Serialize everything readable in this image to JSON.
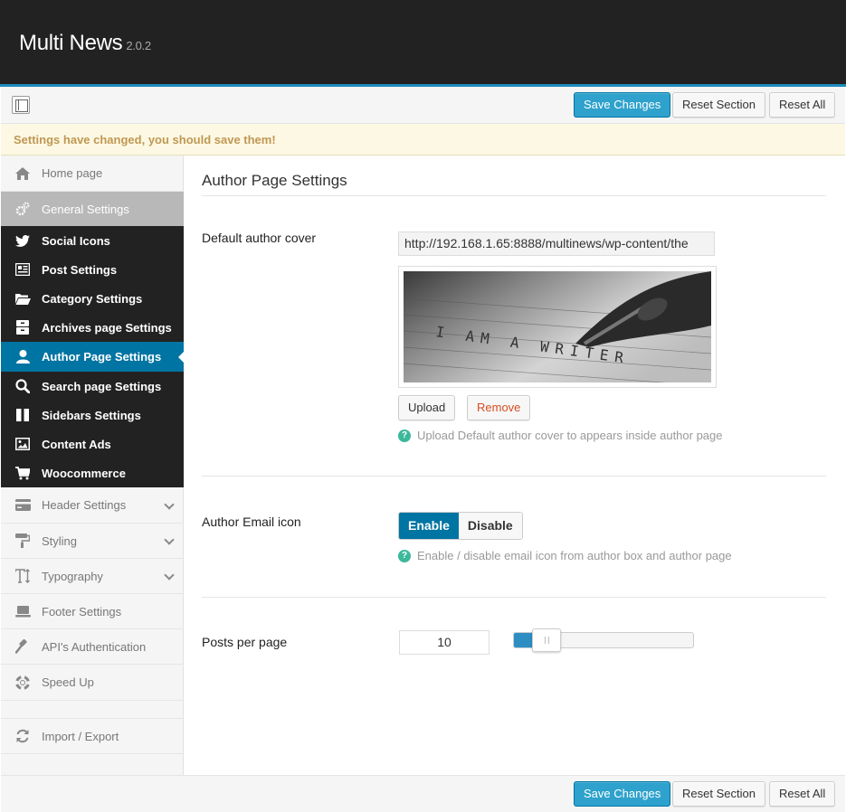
{
  "app": {
    "title": "Multi News",
    "version": "2.0.2"
  },
  "toolbar": {
    "save_label": "Save Changes",
    "reset_section_label": "Reset Section",
    "reset_all_label": "Reset All"
  },
  "notice": "Settings have changed, you should save them!",
  "sidebar": {
    "items": [
      {
        "label": "Home page",
        "icon": "home-icon"
      },
      {
        "label": "General Settings",
        "icon": "gears-icon"
      },
      {
        "label": "Social Icons",
        "icon": "twitter-icon"
      },
      {
        "label": "Post Settings",
        "icon": "post-icon"
      },
      {
        "label": "Category Settings",
        "icon": "folder-icon"
      },
      {
        "label": "Archives page Settings",
        "icon": "archive-icon"
      },
      {
        "label": "Author Page Settings",
        "icon": "user-icon"
      },
      {
        "label": "Search page Settings",
        "icon": "search-icon"
      },
      {
        "label": "Sidebars Settings",
        "icon": "columns-icon"
      },
      {
        "label": "Content Ads",
        "icon": "image-icon"
      },
      {
        "label": "Woocommerce",
        "icon": "cart-icon"
      },
      {
        "label": "Header Settings",
        "icon": "credit-card-icon"
      },
      {
        "label": "Styling",
        "icon": "paint-roller-icon"
      },
      {
        "label": "Typography",
        "icon": "text-height-icon"
      },
      {
        "label": "Footer Settings",
        "icon": "laptop-icon"
      },
      {
        "label": "API's Authentication",
        "icon": "gavel-icon"
      },
      {
        "label": "Speed Up",
        "icon": "life-ring-icon"
      },
      {
        "label": "Import / Export",
        "icon": "refresh-icon"
      }
    ]
  },
  "main": {
    "section_title": "Author Page Settings",
    "cover": {
      "label": "Default author cover",
      "url": "http://192.168.1.65:8888/multinews/wp-content/the",
      "image_text": "I AM A WRITER",
      "upload_label": "Upload",
      "remove_label": "Remove",
      "help": "Upload Default author cover to appears inside author page"
    },
    "email_icon": {
      "label": "Author Email icon",
      "enable_label": "Enable",
      "disable_label": "Disable",
      "selected": "Enable",
      "help": "Enable / disable email icon from author box and author page"
    },
    "posts_per_page": {
      "label": "Posts per page",
      "value": "10",
      "slider_fraction": 0.18
    }
  },
  "colors": {
    "accent": "#0074a2",
    "primary_button": "#2ea2cc",
    "notice_bg": "#fcf8e3",
    "notice_text": "#c09853",
    "help_icon": "#3cb89a",
    "remove": "#d54e21"
  }
}
